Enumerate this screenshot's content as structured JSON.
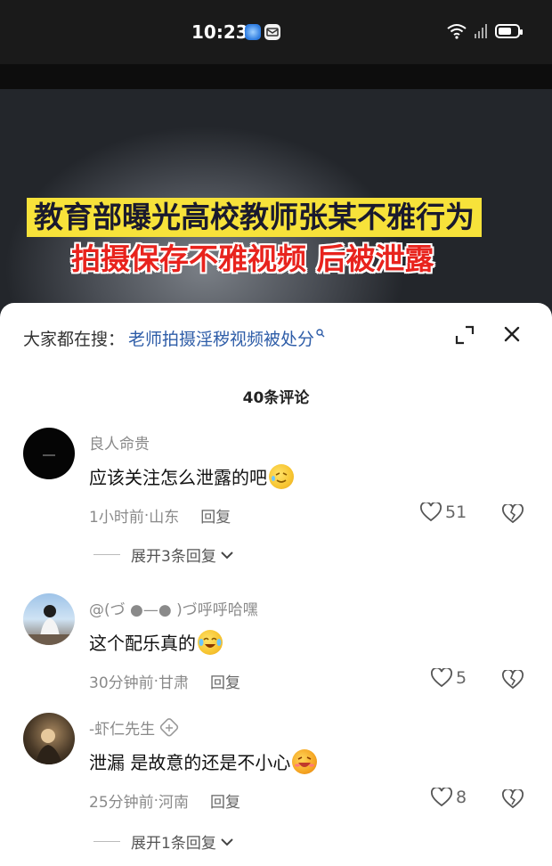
{
  "status_bar": {
    "time": "10:23",
    "icons": [
      "blue-app-icon",
      "mail-app-icon",
      "wifi-icon",
      "signal-icon",
      "battery-icon"
    ]
  },
  "video": {
    "headline_line1": "教育部曝光高校教师张某不雅行为",
    "headline_line2": "拍摄保存不雅视频 后被泄露",
    "headline1_bg": "#f7e23a",
    "headline2_color": "#e8231d"
  },
  "sheet": {
    "search_label": "大家都在搜：",
    "search_query": "老师拍摄淫秽视频被处分",
    "comment_count": "40条评论"
  },
  "comments": [
    {
      "username": "良人命贵",
      "text": "应该关注怎么泄露的吧",
      "time": "1小时前",
      "location": "山东",
      "reply": "回复",
      "likes": "51",
      "expand": "展开3条回复"
    },
    {
      "username": "@(づ ●—● )づ呼呼哈嘿",
      "text": "这个配乐真的",
      "time": "30分钟前",
      "location": "甘肃",
      "reply": "回复",
      "likes": "5"
    },
    {
      "username": "-虾仁先生",
      "text": "泄漏 是故意的还是不小心",
      "time": "25分钟前",
      "location": "河南",
      "reply": "回复",
      "likes": "8",
      "expand": "展开1条回复"
    }
  ],
  "separator": " · ",
  "colors": {
    "link_blue": "#2e5da8",
    "meta_gray": "#8a8a8a"
  }
}
